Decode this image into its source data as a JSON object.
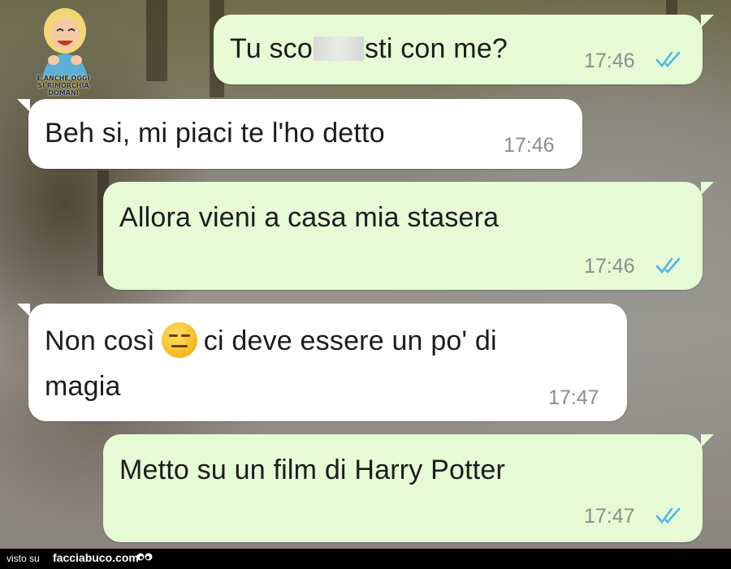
{
  "sticker": {
    "caption_line1": "E ANCHE OGGI",
    "caption_line2": "SI RIMORCHIA DOMANI"
  },
  "messages": [
    {
      "direction": "outgoing",
      "text_before": "Tu sco",
      "text_after": "sti con me?",
      "time": "17:46",
      "read": true
    },
    {
      "direction": "incoming",
      "text": "Beh si, mi piaci te l'ho detto",
      "time": "17:46"
    },
    {
      "direction": "outgoing",
      "text": "Allora vieni a casa mia stasera",
      "time": "17:46",
      "read": true
    },
    {
      "direction": "incoming",
      "text_before": "Non così",
      "emoji": "expressionless-face",
      "text_after": "ci deve essere un po' di",
      "text_line2": "magia",
      "time": "17:47"
    },
    {
      "direction": "outgoing",
      "text": "Metto su un film di Harry Potter",
      "time": "17:47",
      "read": true
    }
  ],
  "footer": {
    "visto_su": "visto su",
    "site": "facciabuco.com"
  },
  "colors": {
    "outgoing_bubble": "#e6fad5",
    "incoming_bubble": "#ffffff",
    "read_tick": "#4fb6ec",
    "time_text": "#8a8f8a"
  }
}
